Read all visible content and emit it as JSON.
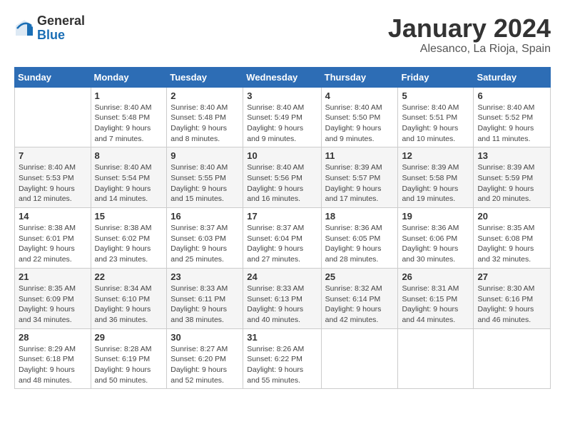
{
  "header": {
    "logo_general": "General",
    "logo_blue": "Blue",
    "month_title": "January 2024",
    "location": "Alesanco, La Rioja, Spain"
  },
  "weekdays": [
    "Sunday",
    "Monday",
    "Tuesday",
    "Wednesday",
    "Thursday",
    "Friday",
    "Saturday"
  ],
  "weeks": [
    [
      {
        "day": "",
        "detail": ""
      },
      {
        "day": "1",
        "detail": "Sunrise: 8:40 AM\nSunset: 5:48 PM\nDaylight: 9 hours\nand 7 minutes."
      },
      {
        "day": "2",
        "detail": "Sunrise: 8:40 AM\nSunset: 5:48 PM\nDaylight: 9 hours\nand 8 minutes."
      },
      {
        "day": "3",
        "detail": "Sunrise: 8:40 AM\nSunset: 5:49 PM\nDaylight: 9 hours\nand 9 minutes."
      },
      {
        "day": "4",
        "detail": "Sunrise: 8:40 AM\nSunset: 5:50 PM\nDaylight: 9 hours\nand 9 minutes."
      },
      {
        "day": "5",
        "detail": "Sunrise: 8:40 AM\nSunset: 5:51 PM\nDaylight: 9 hours\nand 10 minutes."
      },
      {
        "day": "6",
        "detail": "Sunrise: 8:40 AM\nSunset: 5:52 PM\nDaylight: 9 hours\nand 11 minutes."
      }
    ],
    [
      {
        "day": "7",
        "detail": "Sunrise: 8:40 AM\nSunset: 5:53 PM\nDaylight: 9 hours\nand 12 minutes."
      },
      {
        "day": "8",
        "detail": "Sunrise: 8:40 AM\nSunset: 5:54 PM\nDaylight: 9 hours\nand 14 minutes."
      },
      {
        "day": "9",
        "detail": "Sunrise: 8:40 AM\nSunset: 5:55 PM\nDaylight: 9 hours\nand 15 minutes."
      },
      {
        "day": "10",
        "detail": "Sunrise: 8:40 AM\nSunset: 5:56 PM\nDaylight: 9 hours\nand 16 minutes."
      },
      {
        "day": "11",
        "detail": "Sunrise: 8:39 AM\nSunset: 5:57 PM\nDaylight: 9 hours\nand 17 minutes."
      },
      {
        "day": "12",
        "detail": "Sunrise: 8:39 AM\nSunset: 5:58 PM\nDaylight: 9 hours\nand 19 minutes."
      },
      {
        "day": "13",
        "detail": "Sunrise: 8:39 AM\nSunset: 5:59 PM\nDaylight: 9 hours\nand 20 minutes."
      }
    ],
    [
      {
        "day": "14",
        "detail": "Sunrise: 8:38 AM\nSunset: 6:01 PM\nDaylight: 9 hours\nand 22 minutes."
      },
      {
        "day": "15",
        "detail": "Sunrise: 8:38 AM\nSunset: 6:02 PM\nDaylight: 9 hours\nand 23 minutes."
      },
      {
        "day": "16",
        "detail": "Sunrise: 8:37 AM\nSunset: 6:03 PM\nDaylight: 9 hours\nand 25 minutes."
      },
      {
        "day": "17",
        "detail": "Sunrise: 8:37 AM\nSunset: 6:04 PM\nDaylight: 9 hours\nand 27 minutes."
      },
      {
        "day": "18",
        "detail": "Sunrise: 8:36 AM\nSunset: 6:05 PM\nDaylight: 9 hours\nand 28 minutes."
      },
      {
        "day": "19",
        "detail": "Sunrise: 8:36 AM\nSunset: 6:06 PM\nDaylight: 9 hours\nand 30 minutes."
      },
      {
        "day": "20",
        "detail": "Sunrise: 8:35 AM\nSunset: 6:08 PM\nDaylight: 9 hours\nand 32 minutes."
      }
    ],
    [
      {
        "day": "21",
        "detail": "Sunrise: 8:35 AM\nSunset: 6:09 PM\nDaylight: 9 hours\nand 34 minutes."
      },
      {
        "day": "22",
        "detail": "Sunrise: 8:34 AM\nSunset: 6:10 PM\nDaylight: 9 hours\nand 36 minutes."
      },
      {
        "day": "23",
        "detail": "Sunrise: 8:33 AM\nSunset: 6:11 PM\nDaylight: 9 hours\nand 38 minutes."
      },
      {
        "day": "24",
        "detail": "Sunrise: 8:33 AM\nSunset: 6:13 PM\nDaylight: 9 hours\nand 40 minutes."
      },
      {
        "day": "25",
        "detail": "Sunrise: 8:32 AM\nSunset: 6:14 PM\nDaylight: 9 hours\nand 42 minutes."
      },
      {
        "day": "26",
        "detail": "Sunrise: 8:31 AM\nSunset: 6:15 PM\nDaylight: 9 hours\nand 44 minutes."
      },
      {
        "day": "27",
        "detail": "Sunrise: 8:30 AM\nSunset: 6:16 PM\nDaylight: 9 hours\nand 46 minutes."
      }
    ],
    [
      {
        "day": "28",
        "detail": "Sunrise: 8:29 AM\nSunset: 6:18 PM\nDaylight: 9 hours\nand 48 minutes."
      },
      {
        "day": "29",
        "detail": "Sunrise: 8:28 AM\nSunset: 6:19 PM\nDaylight: 9 hours\nand 50 minutes."
      },
      {
        "day": "30",
        "detail": "Sunrise: 8:27 AM\nSunset: 6:20 PM\nDaylight: 9 hours\nand 52 minutes."
      },
      {
        "day": "31",
        "detail": "Sunrise: 8:26 AM\nSunset: 6:22 PM\nDaylight: 9 hours\nand 55 minutes."
      },
      {
        "day": "",
        "detail": ""
      },
      {
        "day": "",
        "detail": ""
      },
      {
        "day": "",
        "detail": ""
      }
    ]
  ]
}
